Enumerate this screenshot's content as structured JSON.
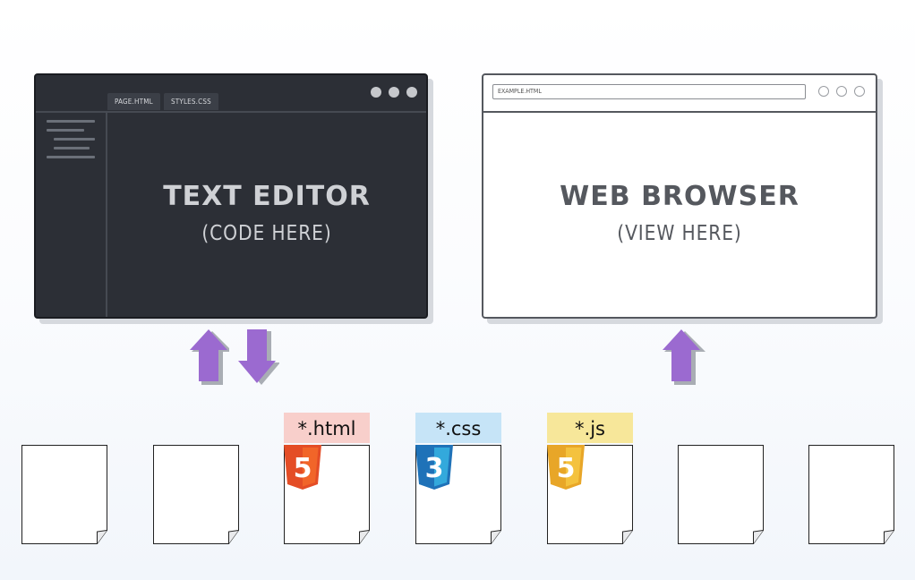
{
  "editor": {
    "tabs": [
      "PAGE.HTML",
      "STYLES.CSS"
    ],
    "title": "TEXT EDITOR",
    "subtitle": "(CODE HERE)"
  },
  "browser": {
    "url": "EXAMPLE.HTML",
    "title": "WEB BROWSER",
    "subtitle": "(VIEW HERE)"
  },
  "files": {
    "html_ext": "*.html",
    "css_ext": "*.css",
    "js_ext": "*.js",
    "html_badge": "5",
    "css_badge": "3",
    "js_badge": "5"
  },
  "colors": {
    "arrow": "#9b6ad0",
    "html_label_bg": "#f8cfcb",
    "css_label_bg": "#c6e4f7",
    "js_label_bg": "#f7e79a",
    "html_shield": "#e44d26",
    "css_shield": "#1f72b8",
    "js_shield": "#e8a628"
  },
  "icons": [
    "html5-icon",
    "css3-icon",
    "js-icon",
    "arrow-up-icon",
    "arrow-down-icon"
  ]
}
